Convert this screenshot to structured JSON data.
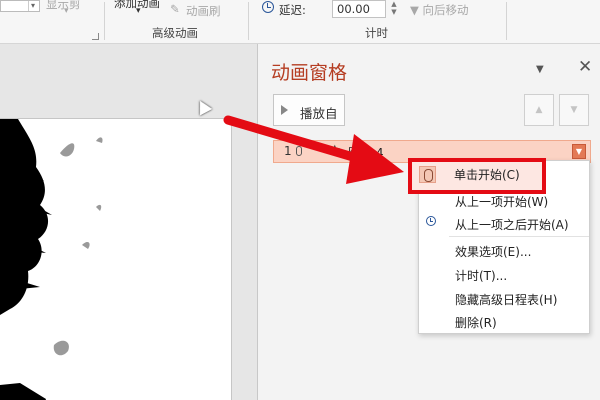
{
  "ribbon": {
    "advanced_group_label": "高级动画",
    "add_animation_label": "添加动画",
    "anim_painter_label": "动画刷",
    "delay_label": "延迟:",
    "delay_value": "00.00",
    "move_later_label": "向后移动",
    "timing_group_label": "计时",
    "truncated_label": "显示剪"
  },
  "pane": {
    "title": "动画窗格",
    "play_label": "播放自",
    "item": {
      "number": "1",
      "label": "图片 4"
    }
  },
  "menu": {
    "items": [
      {
        "label": "单击开始(C)",
        "icon": "mouse-icon"
      },
      {
        "label": "从上一项开始(W)",
        "icon": "none"
      },
      {
        "label": "从上一项之后开始(A)",
        "icon": "clock-icon"
      },
      {
        "label": "效果选项(E)...",
        "icon": "none"
      },
      {
        "label": "计时(T)...",
        "icon": "none"
      },
      {
        "label": "隐藏高级日程表(H)",
        "icon": "none"
      },
      {
        "label": "删除(R)",
        "icon": "none"
      }
    ]
  },
  "colors": {
    "accent": "#b53d22",
    "highlight_border": "#e40b14",
    "item_fill": "#fbd3c4"
  }
}
